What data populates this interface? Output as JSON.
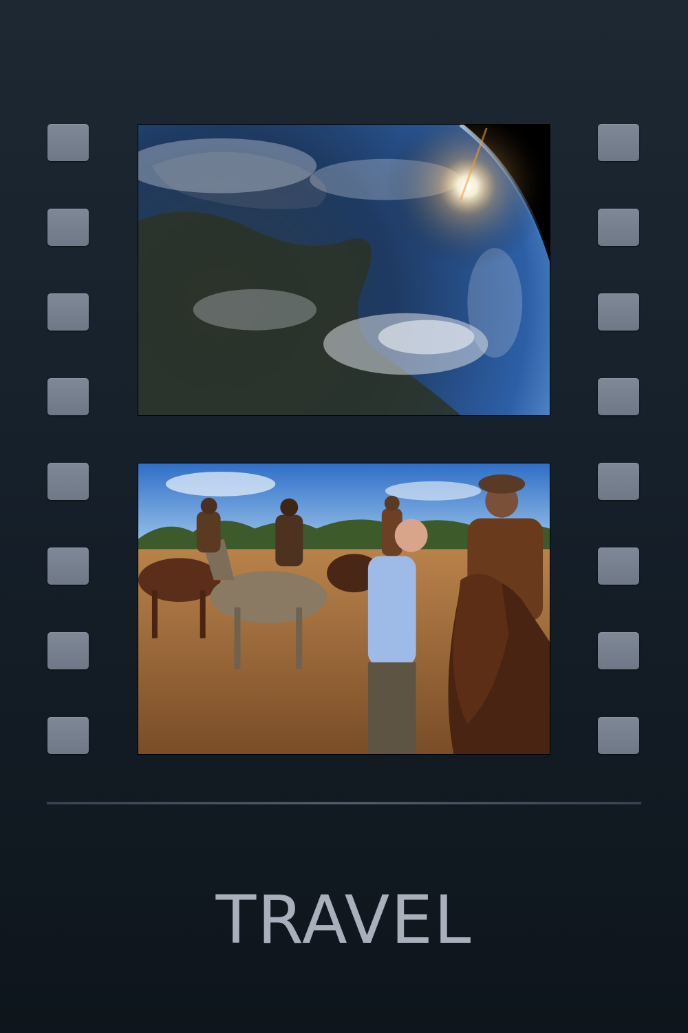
{
  "title": "TRAVEL",
  "colors": {
    "background": "#16202a",
    "sprocket": "#757e8c",
    "title": "#a9b0bc"
  }
}
